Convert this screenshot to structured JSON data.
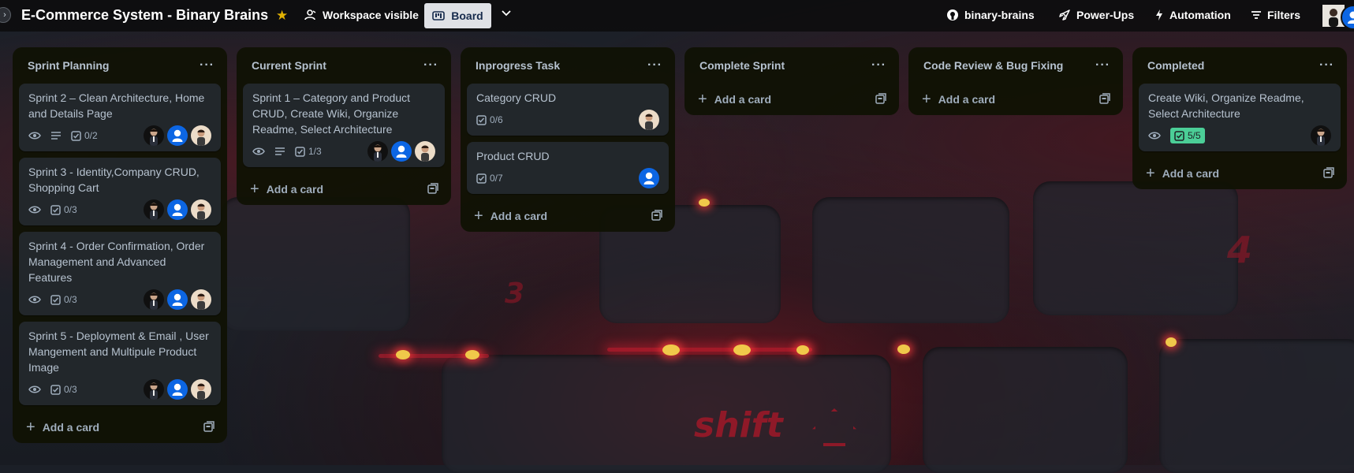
{
  "topbar": {
    "title": "E-Commerce System - Binary Brains",
    "visibility_label": "Workspace visible",
    "view_label": "Board",
    "github_label": "binary-brains",
    "powerups_label": "Power-Ups",
    "automation_label": "Automation",
    "filters_label": "Filters"
  },
  "lists": [
    {
      "title": "Sprint Planning",
      "add_label": "Add a card",
      "cards": [
        {
          "title": "Sprint 2 – Clean Architecture, Home and Details Page",
          "checklist": "0/2"
        },
        {
          "title": "Sprint 3 - Identity,Company CRUD, Shopping Cart",
          "checklist": "0/3"
        },
        {
          "title": "Sprint 4 - Order Confirmation, Order Management and Advanced Features",
          "checklist": "0/3"
        },
        {
          "title": "Sprint 5 - Deployment & Email , User Mangement and Multipule Product Image",
          "checklist": "0/3"
        }
      ]
    },
    {
      "title": "Current Sprint",
      "add_label": "Add a card",
      "cards": [
        {
          "title": "Sprint 1 – Category and Product CRUD, Create Wiki, Organize Readme, Select Architecture",
          "checklist": "1/3"
        }
      ]
    },
    {
      "title": "Inprogress Task",
      "add_label": "Add a card",
      "cards": [
        {
          "title": "Category CRUD",
          "checklist": "0/6"
        },
        {
          "title": "Product CRUD",
          "checklist": "0/7"
        }
      ]
    },
    {
      "title": "Complete Sprint",
      "add_label": "Add a card",
      "cards": []
    },
    {
      "title": "Code Review & Bug Fixing",
      "add_label": "Add a card",
      "cards": []
    },
    {
      "title": "Completed",
      "add_label": "Add a card",
      "cards": [
        {
          "title": "Create Wiki, Organize Readme, Select Architecture",
          "checklist": "5/5"
        }
      ]
    }
  ],
  "background_text": {
    "shift_key": "shift",
    "digit_3": "3",
    "digit_4": "4"
  },
  "colors": {
    "list_bg": "#101204",
    "card_bg": "#22272b",
    "checklist_complete": "#4bce97",
    "star": "#e2b203",
    "avatar_blue": "#0c66e4"
  }
}
